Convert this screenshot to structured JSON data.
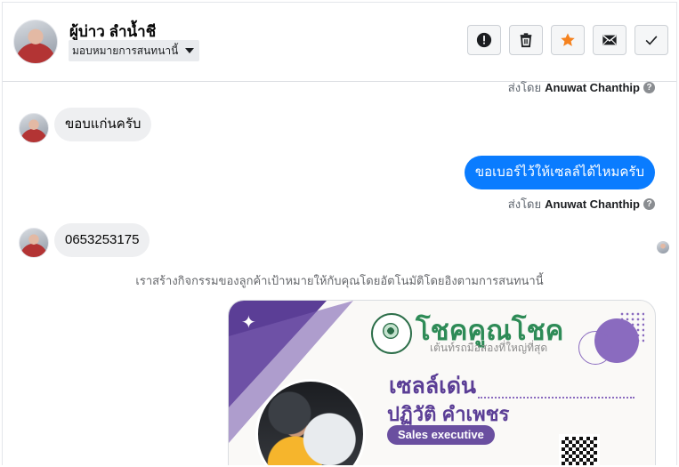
{
  "header": {
    "contact_name": "ผู้บ่าว ลำน้ำชี",
    "assign_label": "มอบหมายการสนทนานี้",
    "actions": [
      {
        "icon": "alert-icon"
      },
      {
        "icon": "trash-icon"
      },
      {
        "icon": "star-icon",
        "color": "#f5821f"
      },
      {
        "icon": "mail-icon"
      },
      {
        "icon": "check-icon"
      }
    ]
  },
  "conversation": {
    "sent_by_prefix": "ส่งโดย",
    "agent_name": "Anuwat Chanthip",
    "help_glyph": "?",
    "msg1_in": "ขอบแก่นครับ",
    "msg2_out": "ขอเบอร์ไว้ให้เซลล์ได้ไหมครับ",
    "msg3_in": "0653253175",
    "system_note": "เราสร้างกิจกรรมของลูกค้าเป้าหมายให้กับคุณโดยอัตโนมัติโดยอิงตามการสนทนานี้"
  },
  "card": {
    "brand": "โชคคูณโชค",
    "tagline": "เต้นท์รถมือสองที่ใหญ่ที่สุด",
    "headline": "เซลล์เด่น",
    "person_name": "ปฏิวัติ คำเพชร",
    "role": "Sales executive",
    "sparkle": "✦"
  },
  "colors": {
    "outgoing_bubble": "#0a7cff",
    "incoming_bubble": "#eeeff1",
    "card_purple": "#5b3e96",
    "brand_green": "#2e8b57"
  }
}
